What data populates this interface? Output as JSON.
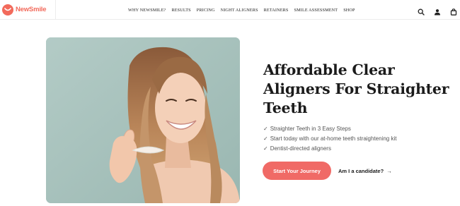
{
  "header": {
    "logo_text": "NewSmile",
    "nav": [
      {
        "label": "WHY NEWSMILE?"
      },
      {
        "label": "RESULTS"
      },
      {
        "label": "PRICING"
      },
      {
        "label": "NIGHT ALIGNERS"
      },
      {
        "label": "RETAINERS"
      },
      {
        "label": "SMILE ASSESSMENT"
      },
      {
        "label": "SHOP"
      }
    ],
    "icons": [
      "search-icon",
      "user-icon",
      "bag-icon"
    ]
  },
  "hero": {
    "title": "Affordable Clear Aligners For Straighter Teeth",
    "benefits": [
      {
        "check": "✓",
        "text": "Straighter Teeth in 3 Easy Steps"
      },
      {
        "check": "✓",
        "text": "Start today with our at-home teeth straightening kit"
      },
      {
        "check": "✓",
        "text": "Dentist-directed aligners"
      }
    ],
    "cta_label": "Start Your Journey",
    "secondary_label": "Am I a candidate?",
    "arrow": "→"
  },
  "colors": {
    "brand": "#f26a5b",
    "cta": "#f06a66",
    "image_bg": "#a8c2bd"
  }
}
